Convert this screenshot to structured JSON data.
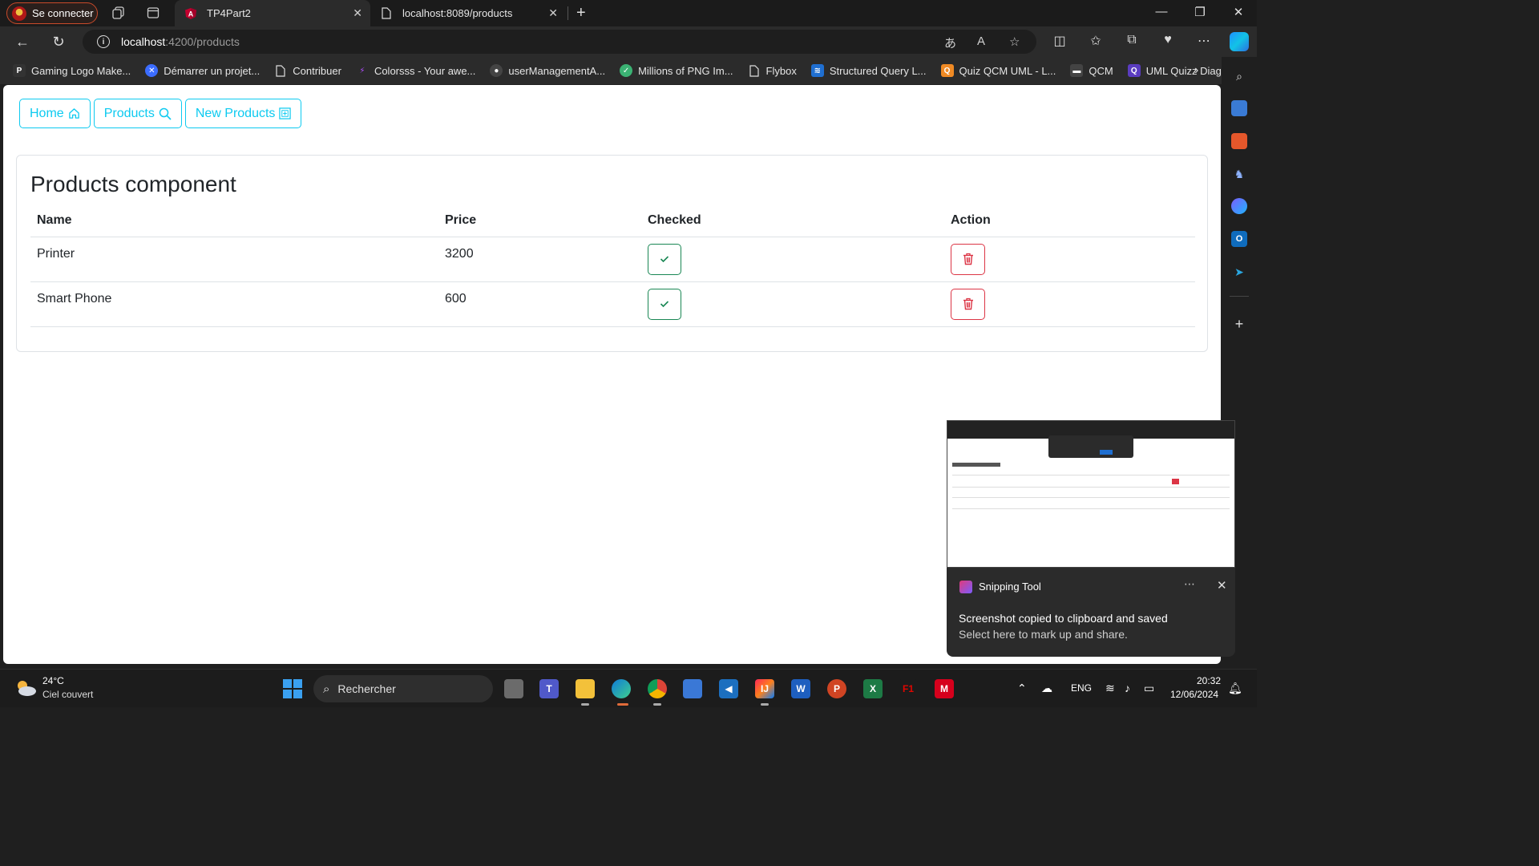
{
  "browser": {
    "profile_label": "Se connecter",
    "tabs": [
      {
        "title": "TP4Part2",
        "active": true
      },
      {
        "title": "localhost:8089/products",
        "active": false
      }
    ],
    "url_host": "localhost",
    "url_path": ":4200/products",
    "favorites": [
      {
        "label": "Gaming Logo Make...",
        "icon": "p-logo-icon",
        "color": "#333333"
      },
      {
        "label": "Démarrer un projet...",
        "icon": "x-circle-icon",
        "color": "#3b6cff"
      },
      {
        "label": "Contribuer",
        "icon": "page-icon",
        "color": "#2b2b2b"
      },
      {
        "label": "Colorsss - Your awe...",
        "icon": "bolt-icon",
        "color": "#7b3cff"
      },
      {
        "label": "userManagementA...",
        "icon": "github-icon",
        "color": "#444444"
      },
      {
        "label": "Millions of PNG Im...",
        "icon": "green-circle-icon",
        "color": "#3bb273"
      },
      {
        "label": "Flybox",
        "icon": "page-icon",
        "color": "#2b2b2b"
      },
      {
        "label": "Structured Query L...",
        "icon": "sql-icon",
        "color": "#1f6fd1"
      },
      {
        "label": "Quiz QCM UML - L...",
        "icon": "quiz-icon",
        "color": "#f08a24"
      },
      {
        "label": "QCM",
        "icon": "qcm-icon",
        "color": "#444444"
      },
      {
        "label": "UML Quizz Diagra...",
        "icon": "q-icon",
        "color": "#5a3cc0"
      }
    ]
  },
  "page": {
    "nav": [
      {
        "label": "Home",
        "icon": "house-icon"
      },
      {
        "label": "Products",
        "icon": "search-icon"
      },
      {
        "label": "New Products",
        "icon": "add-box-icon"
      }
    ],
    "title": "Products component",
    "columns": [
      "Name",
      "Price",
      "Checked",
      "Action"
    ],
    "products": [
      {
        "name": "Printer",
        "price": "3200",
        "checked": true
      },
      {
        "name": "Smart Phone",
        "price": "600",
        "checked": true
      }
    ],
    "colors": {
      "info": "#0dcaf0",
      "success": "#198754",
      "danger": "#dc3545"
    }
  },
  "notification": {
    "app": "Snipping Tool",
    "title": "Screenshot copied to clipboard and saved",
    "body": "Select here to mark up and share."
  },
  "taskbar": {
    "weather_temp": "24°C",
    "weather_desc": "Ciel couvert",
    "search_placeholder": "Rechercher",
    "language": "ENG",
    "time": "20:32",
    "date": "12/06/2024"
  }
}
